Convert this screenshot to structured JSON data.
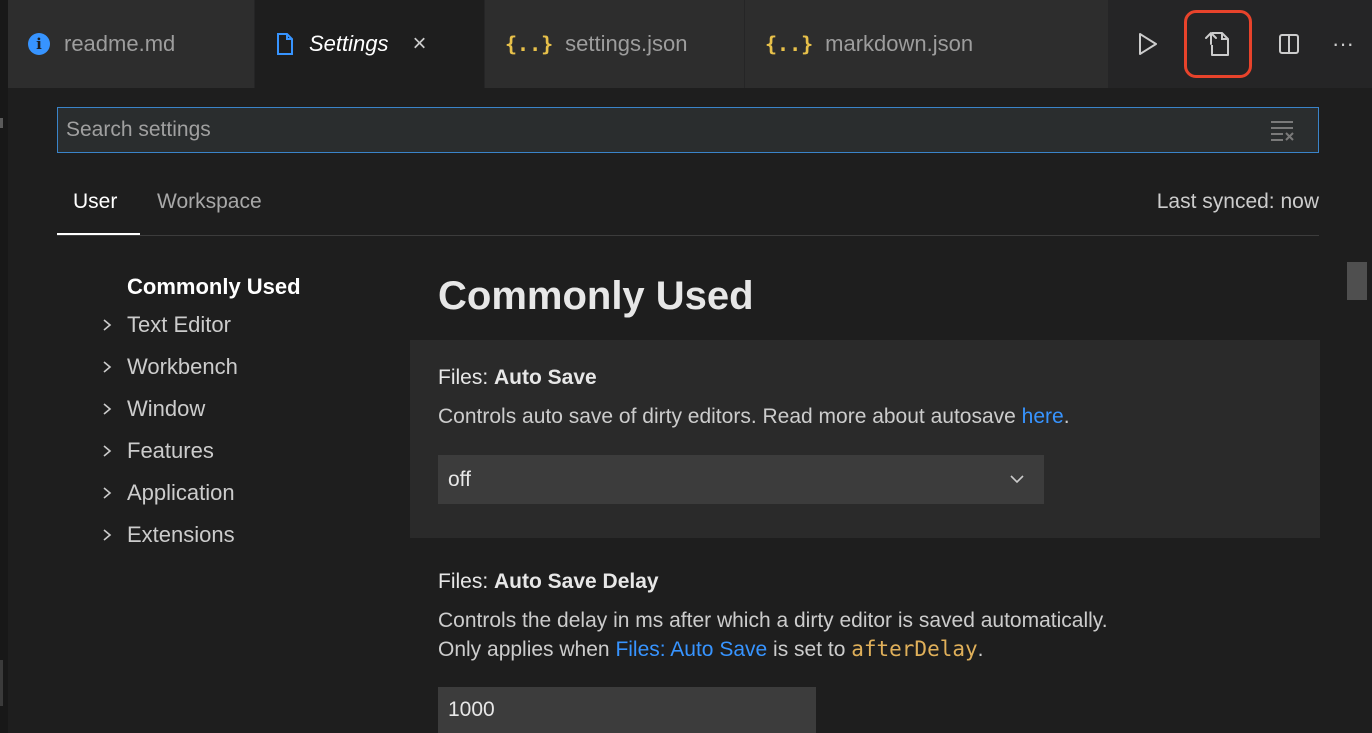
{
  "tabs": [
    {
      "label": "readme.md",
      "icon": "info-icon"
    },
    {
      "label": "Settings",
      "icon": "file-icon",
      "active": true,
      "close": "×"
    },
    {
      "label": "settings.json",
      "icon": "json-icon",
      "glyph": "{..}"
    },
    {
      "label": "markdown.json",
      "icon": "json-icon",
      "glyph": "{..}"
    }
  ],
  "actions": [
    "run-icon",
    "open-settings-json-icon",
    "split-editor-icon",
    "more-actions-icon"
  ],
  "actions_more_glyph": "···",
  "search": {
    "placeholder": "Search settings"
  },
  "scope": {
    "user": "User",
    "workspace": "Workspace",
    "sync_status": "Last synced: now"
  },
  "toc": {
    "heading": "Commonly Used",
    "items": [
      "Text Editor",
      "Workbench",
      "Window",
      "Features",
      "Application",
      "Extensions"
    ]
  },
  "main": {
    "section_title": "Commonly Used",
    "auto_save": {
      "category": "Files: ",
      "name": "Auto Save",
      "desc_prefix": "Controls auto save of dirty editors. Read more about autosave ",
      "desc_link": "here",
      "desc_suffix": ".",
      "value": "off"
    },
    "auto_save_delay": {
      "category": "Files: ",
      "name": "Auto Save Delay",
      "desc_line1": "Controls the delay in ms after which a dirty editor is saved automatically.",
      "desc_prefix2": "Only applies when ",
      "desc_link": "Files: Auto Save",
      "desc_mid": " is set to ",
      "desc_code": "afterDelay",
      "desc_suffix": ".",
      "value": "1000"
    }
  },
  "colors": {
    "accent": "#3794ff",
    "highlight": "#e8432b",
    "json_icon": "#e8c14a",
    "background": "#1e1e1e"
  }
}
